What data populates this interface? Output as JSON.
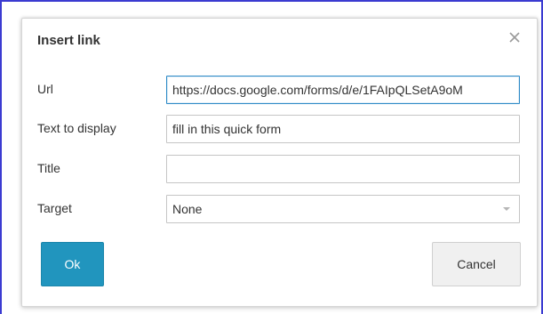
{
  "dialog": {
    "title": "Insert link",
    "close_icon": "close-icon",
    "fields": {
      "url": {
        "label": "Url",
        "value": "https://docs.google.com/forms/d/e/1FAIpQLSetA9oM"
      },
      "text_to_display": {
        "label": "Text to display",
        "value": "fill in this quick form"
      },
      "title": {
        "label": "Title",
        "value": ""
      },
      "target": {
        "label": "Target",
        "value": "None"
      }
    },
    "buttons": {
      "ok": "Ok",
      "cancel": "Cancel"
    }
  },
  "colors": {
    "frame_border": "#3b3bd1",
    "ok_button": "#2195be",
    "focus_border": "#2d8ac7"
  }
}
